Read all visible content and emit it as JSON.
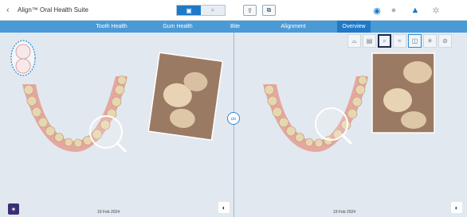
{
  "app": {
    "title": "Align™ Oral Health Suite"
  },
  "view_toggle": {
    "left_icon": "flat-view-icon",
    "right_icon": "search-icon"
  },
  "header_buttons": [
    {
      "icon": "export-icon"
    },
    {
      "icon": "screenshot-icon"
    }
  ],
  "header_right": [
    {
      "icon": "camera-icon"
    },
    {
      "icon": "avatar-icon"
    },
    {
      "icon": "graduation-cap-icon"
    },
    {
      "icon": "gear-icon"
    }
  ],
  "tabs": [
    {
      "label": "Tooth Health"
    },
    {
      "label": "Gum Health"
    },
    {
      "label": "Bite"
    },
    {
      "label": "Alignment"
    },
    {
      "label": "Overview"
    }
  ],
  "active_tab": "Overview",
  "left_pane": {
    "date": "19 Feb 2024"
  },
  "right_pane": {
    "date": "19 Feb 2024"
  },
  "tools": [
    {
      "icon": "jaw-view-icon"
    },
    {
      "icon": "photo-icon"
    },
    {
      "icon": "magnifier-icon"
    },
    {
      "icon": "bite-icon"
    },
    {
      "icon": "split-view-icon"
    },
    {
      "icon": "sparkle-icon"
    },
    {
      "icon": "camera-slash-icon"
    }
  ],
  "colors": {
    "accent": "#1f79c7",
    "tab_bar": "#4a9ad6",
    "lens_ring": "#ffffff"
  }
}
